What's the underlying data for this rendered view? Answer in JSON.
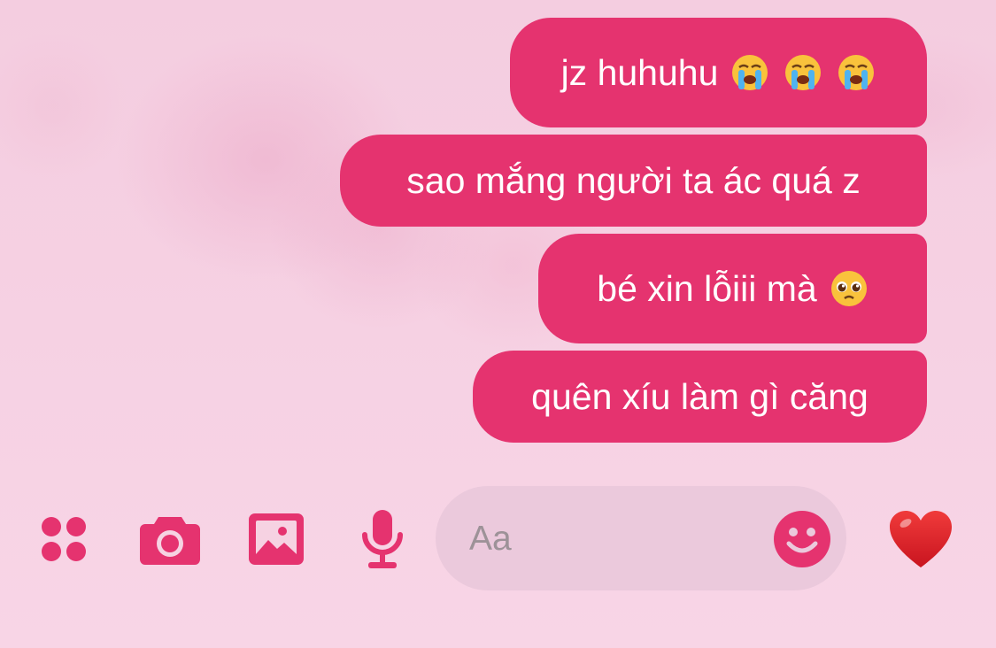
{
  "accent_color": "#e5336f",
  "messages": [
    {
      "text": "jz huhuhu",
      "emojis": [
        "loudly-crying-face",
        "loudly-crying-face",
        "loudly-crying-face"
      ]
    },
    {
      "text": "sao mắng người ta ác quá z",
      "emojis": []
    },
    {
      "text": "bé xin lỗiii mà",
      "emojis": [
        "pleading-face"
      ]
    },
    {
      "text": "quên xíu làm gì căng",
      "emojis": []
    }
  ],
  "composer": {
    "placeholder": "Aa"
  },
  "toolbar": {
    "icons": [
      "apps-grid-icon",
      "camera-icon",
      "image-icon",
      "microphone-icon",
      "emoji-icon",
      "heart-icon"
    ]
  }
}
